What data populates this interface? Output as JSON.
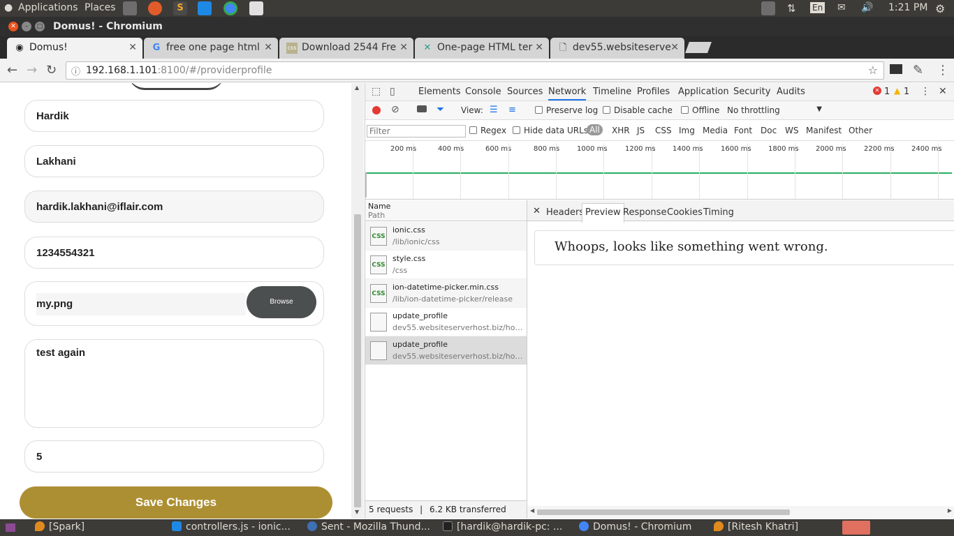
{
  "top_panel": {
    "applications": "Applications",
    "places": "Places",
    "keyboard": "En",
    "clock": "1:21 PM"
  },
  "window": {
    "title": "Domus! - Chromium"
  },
  "tabs": [
    {
      "label": "Domus!",
      "icon": "ionic-icon"
    },
    {
      "label": "free one page html",
      "icon": "google-icon"
    },
    {
      "label": "Download 2544 Fre",
      "icon": "css-icon"
    },
    {
      "label": "One-page HTML ter",
      "icon": "x-logo-icon"
    },
    {
      "label": "dev55.websiteserve",
      "icon": "page-icon"
    }
  ],
  "omnibox": {
    "host": "192.168.1.101",
    "rest": ":8100/#/providerprofile"
  },
  "form": {
    "first_name": "Hardik",
    "last_name": "Lakhani",
    "email": "hardik.lakhani@iflair.com",
    "phone": "1234554321",
    "file": "my.png",
    "browse_label": "Browse",
    "about": "test again",
    "experience": "5",
    "save_label": "Save Changes"
  },
  "devtools": {
    "tabs": [
      "Elements",
      "Console",
      "Sources",
      "Network",
      "Timeline",
      "Profiles",
      "Application",
      "Security",
      "Audits"
    ],
    "active_tab": "Network",
    "errors": "1",
    "warnings": "1",
    "view_label": "View:",
    "preserve_log": "Preserve log",
    "disable_cache": "Disable cache",
    "offline": "Offline",
    "throttling": "No throttling",
    "filter_placeholder": "Filter",
    "regex": "Regex",
    "hide_data_urls": "Hide data URLs",
    "types": [
      "All",
      "XHR",
      "JS",
      "CSS",
      "Img",
      "Media",
      "Font",
      "Doc",
      "WS",
      "Manifest",
      "Other"
    ],
    "ticks": [
      "200 ms",
      "400 ms",
      "600 ms",
      "800 ms",
      "1000 ms",
      "1200 ms",
      "1400 ms",
      "1600 ms",
      "1800 ms",
      "2000 ms",
      "2200 ms",
      "2400 ms"
    ],
    "col_name": "Name",
    "col_path": "Path",
    "requests": [
      {
        "name": "ionic.css",
        "path": "/lib/ionic/css",
        "type": "css"
      },
      {
        "name": "style.css",
        "path": "/css",
        "type": "css"
      },
      {
        "name": "ion-datetime-picker.min.css",
        "path": "/lib/ion-datetime-picker/release",
        "type": "css"
      },
      {
        "name": "update_profile",
        "path": "dev55.websiteserverhost.biz/home...",
        "type": "doc"
      },
      {
        "name": "update_profile",
        "path": "dev55.websiteserverhost.biz/home...",
        "type": "doc"
      }
    ],
    "panel_tabs": [
      "Headers",
      "Preview",
      "Response",
      "Cookies",
      "Timing"
    ],
    "active_panel_tab": "Preview",
    "preview_text": "Whoops, looks like something went wrong.",
    "summary_requests": "5 requests",
    "summary_sep": "|",
    "summary_transferred": "6.2 KB transferred"
  },
  "taskbar": [
    {
      "label": "[Spark]"
    },
    {
      "label": "controllers.js - ionic..."
    },
    {
      "label": "Sent - Mozilla Thund..."
    },
    {
      "label": "[hardik@hardik-pc: ..."
    },
    {
      "label": "Domus! - Chromium"
    },
    {
      "label": "[Ritesh Khatri]"
    }
  ],
  "colors": {
    "save_button": "#ad8f33",
    "panel": "#3c3b37",
    "active_devtools_tab": "#1a73e8",
    "record": "#e53935"
  }
}
